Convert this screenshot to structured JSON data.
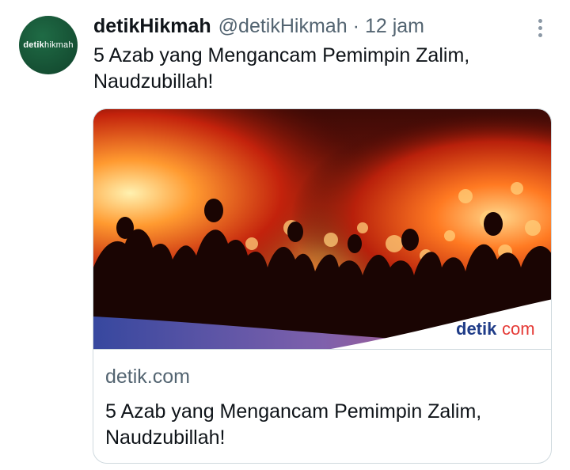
{
  "author": {
    "display_name": "detikHikmah",
    "handle": "@detikHikmah",
    "separator": "·",
    "time": "12 jam",
    "avatar_text_bold": "detik",
    "avatar_text_light": "hikmah"
  },
  "tweet": {
    "text": "5 Azab yang Mengancam Pemimpin Zalim, Naudzubillah!"
  },
  "card": {
    "image_watermark_bold": "detik",
    "image_watermark_light": "com",
    "domain": "detik.com",
    "title": "5 Azab yang Mengancam Pemimpin Zalim, Naudzubillah!"
  },
  "icons": {
    "more": "more-vertical-icon"
  },
  "colors": {
    "name": "#0f1419",
    "secondary": "#536471",
    "border": "#cfd9de",
    "avatar_bg": "#154f33",
    "watermark_red": "#e53935",
    "watermark_blue": "#1f3c88"
  }
}
